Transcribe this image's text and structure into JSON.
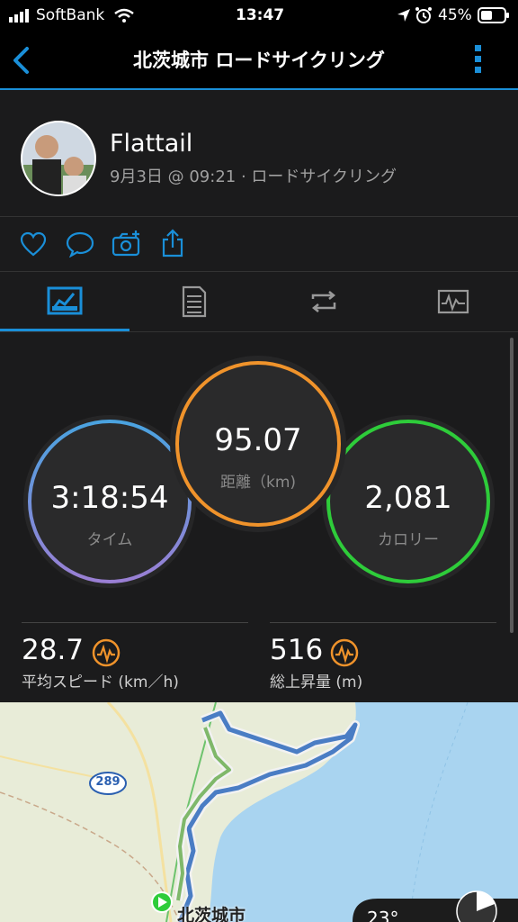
{
  "status": {
    "carrier": "SoftBank",
    "time": "13:47",
    "battery": "45%"
  },
  "nav": {
    "title": "北茨城市 ロードサイクリング"
  },
  "profile": {
    "name": "Flattail",
    "meta": "9月3日 @ 09:21 · ロードサイクリング"
  },
  "stats": {
    "time": {
      "value": "3:18:54",
      "label": "タイム"
    },
    "distance": {
      "value": "95.07",
      "label": "距離（km)"
    },
    "calories": {
      "value": "2,081",
      "label": "カロリー"
    },
    "avg_speed": {
      "value": "28.7",
      "label": "平均スピード (km／h)"
    },
    "elevation": {
      "value": "516",
      "label": "総上昇量 (m)"
    }
  },
  "map": {
    "route_badge": "289",
    "city": "北茨城市",
    "weather": "23°"
  },
  "colors": {
    "accent": "#1a8fd8",
    "time_ring": "#5aa9e8",
    "distance_ring": "#f0932b",
    "calories_ring": "#2ecc3a",
    "metric_icon": "#f0932b"
  }
}
